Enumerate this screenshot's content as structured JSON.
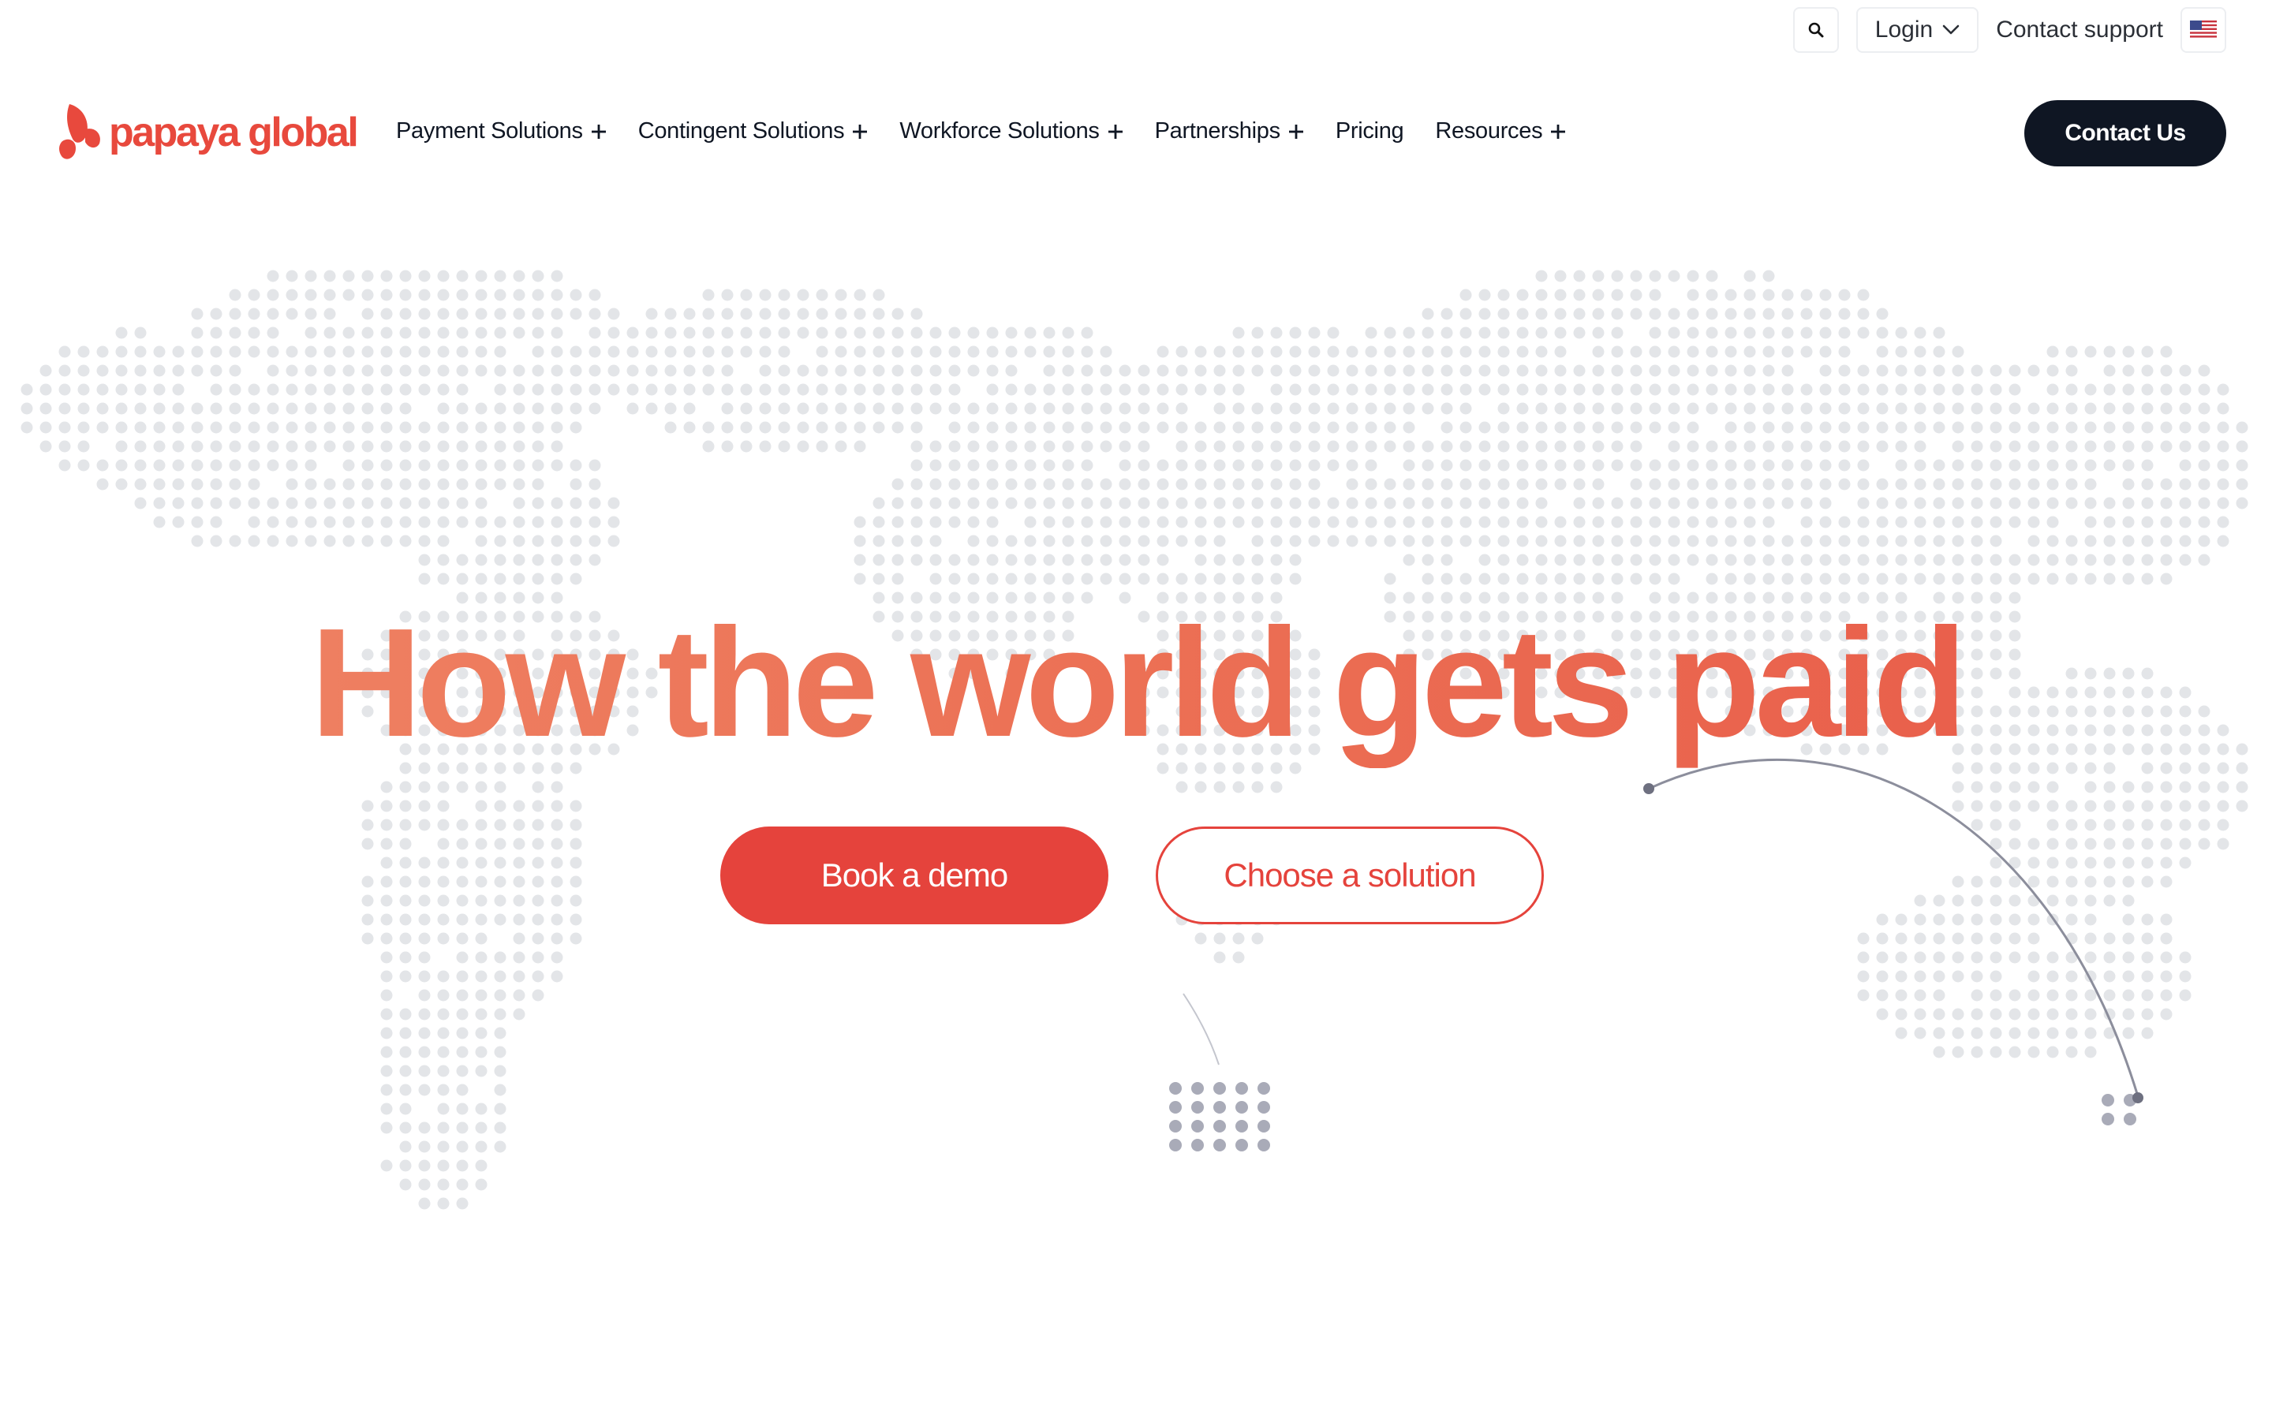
{
  "utility": {
    "search_icon": "search-icon",
    "login_label": "Login",
    "support_label": "Contact support",
    "flag_icon": "us-flag-icon"
  },
  "brand": {
    "name": "papaya global",
    "color": "#e8493d"
  },
  "nav": {
    "items": [
      {
        "label": "Payment Solutions",
        "has_submenu": true
      },
      {
        "label": "Contingent Solutions",
        "has_submenu": true
      },
      {
        "label": "Workforce Solutions",
        "has_submenu": true
      },
      {
        "label": "Partnerships",
        "has_submenu": true
      },
      {
        "label": "Pricing",
        "has_submenu": false
      },
      {
        "label": "Resources",
        "has_submenu": true
      }
    ],
    "contact_label": "Contact Us"
  },
  "hero": {
    "title": "How the world gets paid",
    "primary_cta": "Book a demo",
    "secondary_cta": "Choose a solution"
  },
  "colors": {
    "accent": "#e5433c",
    "dark": "#0f1623",
    "map_dot": "#e3e5e8"
  }
}
